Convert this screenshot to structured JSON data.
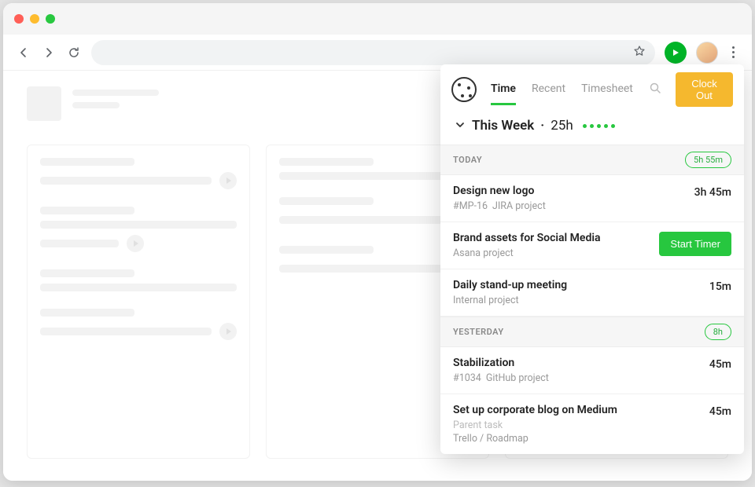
{
  "panel": {
    "tabs": {
      "time": "Time",
      "recent": "Recent",
      "timesheet": "Timesheet"
    },
    "clock_out": "Clock Out",
    "week": {
      "label": "This Week",
      "separator": "·",
      "hours": "25h",
      "dot_count": 5
    },
    "sections": [
      {
        "label": "TODAY",
        "badge": "5h 55m",
        "entries": [
          {
            "title": "Design new logo",
            "tag": "#MP-16",
            "project": "JIRA project",
            "time": "3h 45m",
            "action": null
          },
          {
            "title": "Brand assets for Social Media",
            "tag": null,
            "project": "Asana project",
            "time": null,
            "action": "Start Timer"
          },
          {
            "title": "Daily stand-up meeting",
            "tag": null,
            "project": "Internal project",
            "time": "15m",
            "action": null
          }
        ]
      },
      {
        "label": "YESTERDAY",
        "badge": "8h",
        "entries": [
          {
            "title": "Stabilization",
            "tag": "#1034",
            "project": "GitHub project",
            "time": "45m",
            "action": null
          },
          {
            "title": "Set up corporate blog on Medium",
            "tag": null,
            "parent": "Parent task",
            "project": "Trello / Roadmap",
            "time": "45m",
            "action": null
          }
        ]
      }
    ]
  }
}
